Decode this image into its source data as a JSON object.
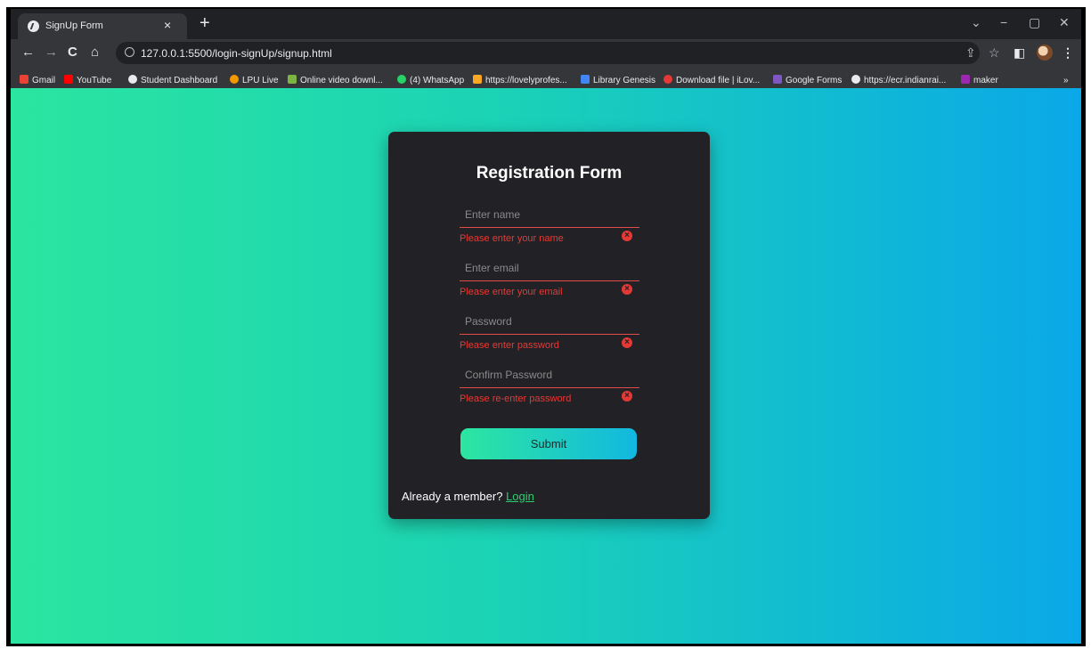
{
  "browser": {
    "tab_title": "SignUp Form",
    "tab_close": "×",
    "new_tab": "+",
    "url": "127.0.0.1:5500/login-signUp/signup.html",
    "window_controls": {
      "chevron": "⌄",
      "minimize": "−",
      "restore": "▢",
      "close": "✕"
    },
    "nav": {
      "back": "←",
      "forward": "→",
      "reload": "C",
      "home": "⌂"
    },
    "tools": {
      "share": "⇪",
      "star": "☆",
      "sidebar": "◧",
      "menu": "⋮"
    },
    "bookmarks": [
      {
        "label": "Gmail",
        "color": "#ea4335"
      },
      {
        "label": "YouTube",
        "color": "#ff0000"
      },
      {
        "label": "Student Dashboard",
        "color": "#e8eaed"
      },
      {
        "label": "LPU Live",
        "color": "#f29900"
      },
      {
        "label": "Online video downl...",
        "color": "#7cb342"
      },
      {
        "label": "(4) WhatsApp",
        "color": "#25d366"
      },
      {
        "label": "https://lovelyprofes...",
        "color": "#f9a825"
      },
      {
        "label": "Library Genesis",
        "color": "#4285f4"
      },
      {
        "label": "Download file | iLov...",
        "color": "#e53935"
      },
      {
        "label": "Google Forms",
        "color": "#7e57c2"
      },
      {
        "label": "https://ecr.indianrai...",
        "color": "#e8eaed"
      },
      {
        "label": "maker",
        "color": "#9c27b0"
      }
    ],
    "bookmarks_more": "»"
  },
  "form": {
    "title": "Registration Form",
    "fields": [
      {
        "placeholder": "Enter name",
        "error": "Please enter your name"
      },
      {
        "placeholder": "Enter email",
        "error": "Please enter your email"
      },
      {
        "placeholder": "Password",
        "error": "Please enter password"
      },
      {
        "placeholder": "Confirm Password",
        "error": "Please re-enter password"
      }
    ],
    "error_icon": "×",
    "submit_label": "Submit",
    "member_text": "Already a member?",
    "login_label": "Login"
  },
  "colors": {
    "gradient_start": "#2ae5a0",
    "gradient_end": "#0aa8e8",
    "error": "#e53935",
    "link": "#2ecc71"
  }
}
